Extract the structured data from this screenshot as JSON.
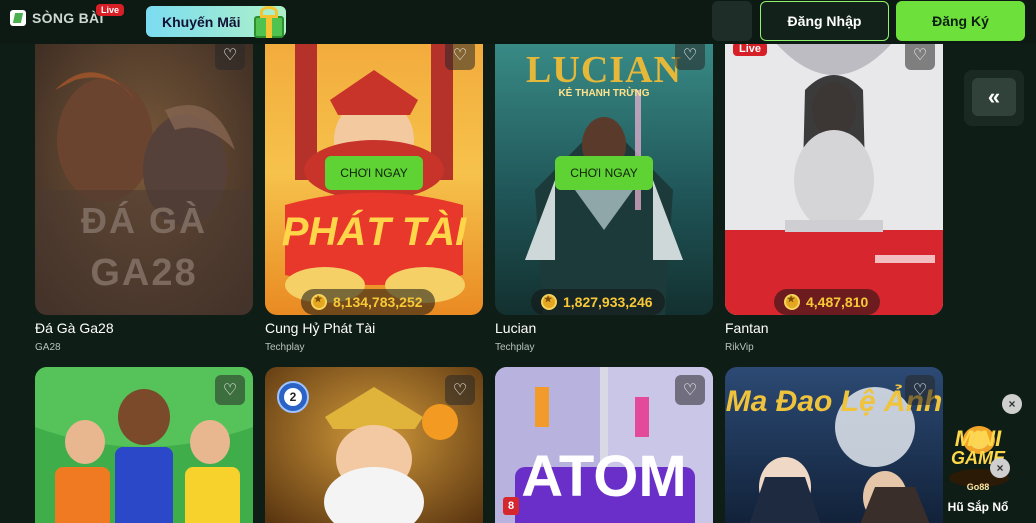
{
  "header": {
    "logo_text": "SÒNG BÀI",
    "live_badge": "Live",
    "promo_label": "Khuyến Mãi",
    "login_label": "Đăng Nhập",
    "register_label": "Đăng Ký"
  },
  "collapse_label": "«",
  "play_label": "CHƠI NGAY",
  "games_row1": [
    {
      "title": "Đá Gà Ga28",
      "provider": "GA28",
      "thumb_text_top": "ĐÁ GÀ",
      "thumb_text_bottom": "GA28"
    },
    {
      "title": "Cung Hỷ Phát Tài",
      "provider": "Techplay",
      "jackpot": "8,134,783,252",
      "thumb_text": "PHÁT TÀI"
    },
    {
      "title": "Lucian",
      "provider": "Techplay",
      "jackpot": "1,827,933,246",
      "thumb_text_top": "LUCIAN",
      "thumb_text_sub": "KẺ THANH TRỪNG"
    },
    {
      "title": "Fantan",
      "provider": "RikVip",
      "jackpot": "4,487,810",
      "live_tag": "Live"
    }
  ],
  "games_row2": [
    {
      "title": "",
      "provider": ""
    },
    {
      "title": "",
      "provider": "",
      "ball_number": "2"
    },
    {
      "title": "",
      "provider": "",
      "thumb_text": "ATOM",
      "small_number": "8"
    },
    {
      "title": "",
      "provider": "",
      "thumb_text": "Ma Đao Lệ Ảnh"
    }
  ],
  "mini_game": {
    "logo_top": "MINI",
    "logo_bottom": "GAME",
    "brand": "Go88",
    "label": "Hũ Sắp Nổ",
    "close": "×"
  },
  "colors": {
    "accent_green": "#6ee03c",
    "jackpot_gold": "#f7c936",
    "live_red": "#d61f26"
  }
}
